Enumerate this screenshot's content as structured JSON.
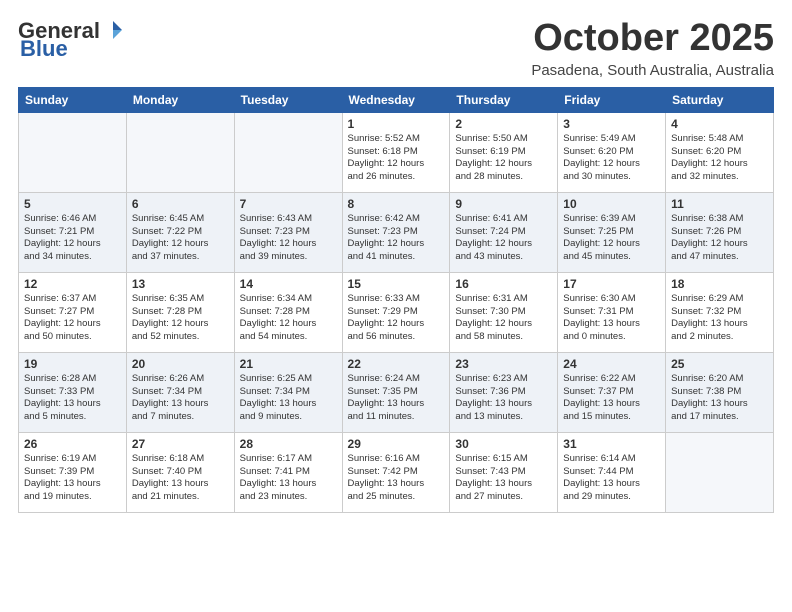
{
  "header": {
    "logo_general": "General",
    "logo_blue": "Blue",
    "month_title": "October 2025",
    "location": "Pasadena, South Australia, Australia"
  },
  "days_of_week": [
    "Sunday",
    "Monday",
    "Tuesday",
    "Wednesday",
    "Thursday",
    "Friday",
    "Saturday"
  ],
  "weeks": [
    [
      {
        "day": "",
        "info": ""
      },
      {
        "day": "",
        "info": ""
      },
      {
        "day": "",
        "info": ""
      },
      {
        "day": "1",
        "info": "Sunrise: 5:52 AM\nSunset: 6:18 PM\nDaylight: 12 hours\nand 26 minutes."
      },
      {
        "day": "2",
        "info": "Sunrise: 5:50 AM\nSunset: 6:19 PM\nDaylight: 12 hours\nand 28 minutes."
      },
      {
        "day": "3",
        "info": "Sunrise: 5:49 AM\nSunset: 6:20 PM\nDaylight: 12 hours\nand 30 minutes."
      },
      {
        "day": "4",
        "info": "Sunrise: 5:48 AM\nSunset: 6:20 PM\nDaylight: 12 hours\nand 32 minutes."
      }
    ],
    [
      {
        "day": "5",
        "info": "Sunrise: 6:46 AM\nSunset: 7:21 PM\nDaylight: 12 hours\nand 34 minutes."
      },
      {
        "day": "6",
        "info": "Sunrise: 6:45 AM\nSunset: 7:22 PM\nDaylight: 12 hours\nand 37 minutes."
      },
      {
        "day": "7",
        "info": "Sunrise: 6:43 AM\nSunset: 7:23 PM\nDaylight: 12 hours\nand 39 minutes."
      },
      {
        "day": "8",
        "info": "Sunrise: 6:42 AM\nSunset: 7:23 PM\nDaylight: 12 hours\nand 41 minutes."
      },
      {
        "day": "9",
        "info": "Sunrise: 6:41 AM\nSunset: 7:24 PM\nDaylight: 12 hours\nand 43 minutes."
      },
      {
        "day": "10",
        "info": "Sunrise: 6:39 AM\nSunset: 7:25 PM\nDaylight: 12 hours\nand 45 minutes."
      },
      {
        "day": "11",
        "info": "Sunrise: 6:38 AM\nSunset: 7:26 PM\nDaylight: 12 hours\nand 47 minutes."
      }
    ],
    [
      {
        "day": "12",
        "info": "Sunrise: 6:37 AM\nSunset: 7:27 PM\nDaylight: 12 hours\nand 50 minutes."
      },
      {
        "day": "13",
        "info": "Sunrise: 6:35 AM\nSunset: 7:28 PM\nDaylight: 12 hours\nand 52 minutes."
      },
      {
        "day": "14",
        "info": "Sunrise: 6:34 AM\nSunset: 7:28 PM\nDaylight: 12 hours\nand 54 minutes."
      },
      {
        "day": "15",
        "info": "Sunrise: 6:33 AM\nSunset: 7:29 PM\nDaylight: 12 hours\nand 56 minutes."
      },
      {
        "day": "16",
        "info": "Sunrise: 6:31 AM\nSunset: 7:30 PM\nDaylight: 12 hours\nand 58 minutes."
      },
      {
        "day": "17",
        "info": "Sunrise: 6:30 AM\nSunset: 7:31 PM\nDaylight: 13 hours\nand 0 minutes."
      },
      {
        "day": "18",
        "info": "Sunrise: 6:29 AM\nSunset: 7:32 PM\nDaylight: 13 hours\nand 2 minutes."
      }
    ],
    [
      {
        "day": "19",
        "info": "Sunrise: 6:28 AM\nSunset: 7:33 PM\nDaylight: 13 hours\nand 5 minutes."
      },
      {
        "day": "20",
        "info": "Sunrise: 6:26 AM\nSunset: 7:34 PM\nDaylight: 13 hours\nand 7 minutes."
      },
      {
        "day": "21",
        "info": "Sunrise: 6:25 AM\nSunset: 7:34 PM\nDaylight: 13 hours\nand 9 minutes."
      },
      {
        "day": "22",
        "info": "Sunrise: 6:24 AM\nSunset: 7:35 PM\nDaylight: 13 hours\nand 11 minutes."
      },
      {
        "day": "23",
        "info": "Sunrise: 6:23 AM\nSunset: 7:36 PM\nDaylight: 13 hours\nand 13 minutes."
      },
      {
        "day": "24",
        "info": "Sunrise: 6:22 AM\nSunset: 7:37 PM\nDaylight: 13 hours\nand 15 minutes."
      },
      {
        "day": "25",
        "info": "Sunrise: 6:20 AM\nSunset: 7:38 PM\nDaylight: 13 hours\nand 17 minutes."
      }
    ],
    [
      {
        "day": "26",
        "info": "Sunrise: 6:19 AM\nSunset: 7:39 PM\nDaylight: 13 hours\nand 19 minutes."
      },
      {
        "day": "27",
        "info": "Sunrise: 6:18 AM\nSunset: 7:40 PM\nDaylight: 13 hours\nand 21 minutes."
      },
      {
        "day": "28",
        "info": "Sunrise: 6:17 AM\nSunset: 7:41 PM\nDaylight: 13 hours\nand 23 minutes."
      },
      {
        "day": "29",
        "info": "Sunrise: 6:16 AM\nSunset: 7:42 PM\nDaylight: 13 hours\nand 25 minutes."
      },
      {
        "day": "30",
        "info": "Sunrise: 6:15 AM\nSunset: 7:43 PM\nDaylight: 13 hours\nand 27 minutes."
      },
      {
        "day": "31",
        "info": "Sunrise: 6:14 AM\nSunset: 7:44 PM\nDaylight: 13 hours\nand 29 minutes."
      },
      {
        "day": "",
        "info": ""
      }
    ]
  ]
}
